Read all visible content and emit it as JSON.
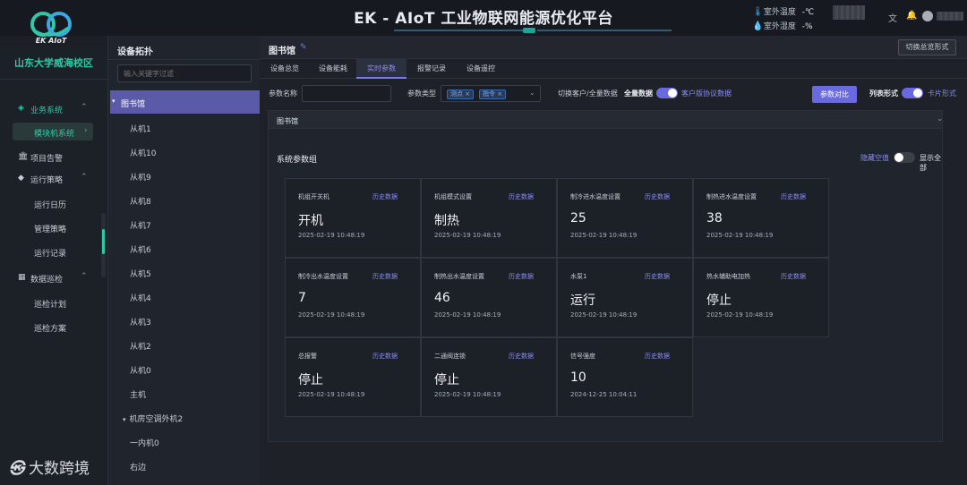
{
  "header": {
    "title": "EK - AIoT 工业物联网能源优化平台",
    "logo_text": "EK AIoT",
    "weather": [
      {
        "label": "室外温度",
        "value": "-℃"
      },
      {
        "label": "室外湿度",
        "value": "-%"
      }
    ]
  },
  "nav": {
    "campus": "山东大学威海校区",
    "groups": [
      {
        "label": "业务系统",
        "items": [
          "模块机系统"
        ]
      },
      {
        "label": "项目告警",
        "items": []
      },
      {
        "label": "运行策略",
        "items": [
          "运行日历",
          "管理策略",
          "运行记录"
        ]
      },
      {
        "label": "数据巡检",
        "items": [
          "巡检计划",
          "巡检方案"
        ]
      }
    ],
    "icons": {
      "business": "diamond-icon",
      "alarm": "bank-icon",
      "strategy": "cube-icon",
      "inspect": "grid-icon"
    }
  },
  "tree": {
    "title": "设备拓扑",
    "filter_placeholder": "输入关键字过滤",
    "selected": "图书馆",
    "nodes": [
      "从机1",
      "从机10",
      "从机9",
      "从机8",
      "从机7",
      "从机6",
      "从机5",
      "从机4",
      "从机3",
      "从机2",
      "从机0",
      "主机"
    ],
    "group2": "机房空调外机2",
    "group2_nodes": [
      "一内机0",
      "右边"
    ]
  },
  "page": {
    "title": "图书馆",
    "switch_button": "切换总览形式",
    "tabs": [
      "设备总览",
      "设备能耗",
      "实时参数",
      "报警记录",
      "设备遥控"
    ],
    "active_tab": "实时参数"
  },
  "filters": {
    "param_name_label": "参数名称",
    "param_type_label": "参数类型",
    "param_type_tags": [
      "测点",
      "指令"
    ],
    "switch_label": "切换客户/全量数据",
    "full_data": "全量数据",
    "client_data": "客户版协议数据",
    "compare_button": "参数对比",
    "list_mode": "列表形式",
    "card_mode": "卡片形式"
  },
  "panel": {
    "collapse_title": "图书馆",
    "group_title": "系统参数组",
    "hide_null": "隐藏空值",
    "show_all": "显示全部",
    "history_label": "历史数据",
    "params": [
      {
        "name": "机组开关机",
        "value": "开机",
        "time": "2025-02-19 10:48:19"
      },
      {
        "name": "机组模式设置",
        "value": "制热",
        "time": "2025-02-19 10:48:19"
      },
      {
        "name": "制冷进水温度设置",
        "value": "25",
        "time": "2025-02-19 10:48:19"
      },
      {
        "name": "制热进水温度设置",
        "value": "38",
        "time": "2025-02-19 10:48:19"
      },
      {
        "name": "制冷出水温度设置",
        "value": "7",
        "time": "2025-02-19 10:48:19"
      },
      {
        "name": "制热出水温度设置",
        "value": "46",
        "time": "2025-02-19 10:48:19"
      },
      {
        "name": "水泵1",
        "value": "运行",
        "time": "2025-02-19 10:48:19"
      },
      {
        "name": "热水辅助电加热",
        "value": "停止",
        "time": "2025-02-19 10:48:19"
      },
      {
        "name": "总报警",
        "value": "停止",
        "time": "2025-02-19 10:48:19"
      },
      {
        "name": "二通阀连锁",
        "value": "停止",
        "time": "2025-02-19 10:48:19"
      },
      {
        "name": "信号强度",
        "value": "10",
        "time": "2024-12-25 10:04:11"
      }
    ]
  },
  "watermark": "大数跨境",
  "colors": {
    "accent": "#6a6ae0",
    "green": "#2fc9a7",
    "bg": "#1c1f26"
  }
}
